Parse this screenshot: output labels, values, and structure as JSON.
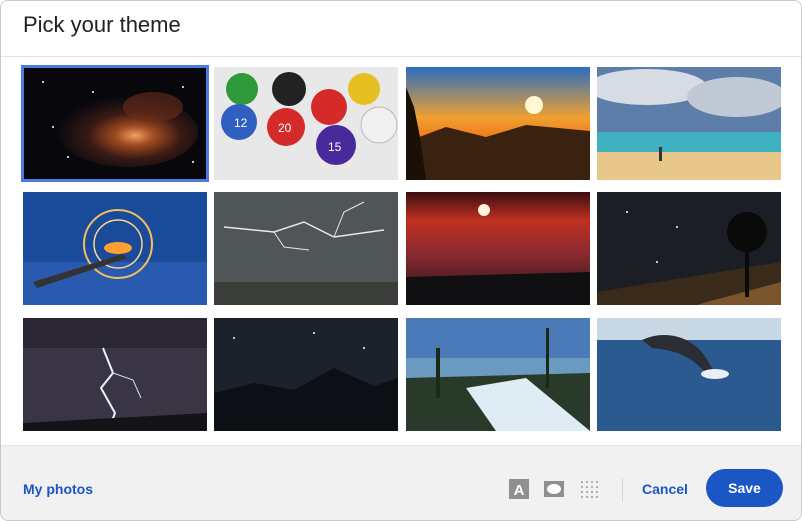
{
  "dialog": {
    "title": "Pick your theme"
  },
  "themes": [
    {
      "name": "galaxy-nebula-thumbnail",
      "selected": true
    },
    {
      "name": "dice-thumbnail",
      "selected": false
    },
    {
      "name": "sunset-valley-thumbnail",
      "selected": false
    },
    {
      "name": "beach-thumbnail",
      "selected": false
    },
    {
      "name": "steel-wool-pier-thumbnail",
      "selected": false
    },
    {
      "name": "lightning-sky-thumbnail",
      "selected": false
    },
    {
      "name": "red-sunset-sea-thumbnail",
      "selected": false
    },
    {
      "name": "milky-way-tree-thumbnail",
      "selected": false
    },
    {
      "name": "lightning-strike-thumbnail",
      "selected": false
    },
    {
      "name": "night-mountains-thumbnail",
      "selected": false
    },
    {
      "name": "waterfall-lake-thumbnail",
      "selected": false
    },
    {
      "name": "whale-breach-thumbnail",
      "selected": false
    }
  ],
  "footer": {
    "my_photos_label": "My photos",
    "cancel_label": "Cancel",
    "save_label": "Save"
  },
  "colors": {
    "accent": "#1a56c4",
    "selected_border": "#4c7be0"
  }
}
